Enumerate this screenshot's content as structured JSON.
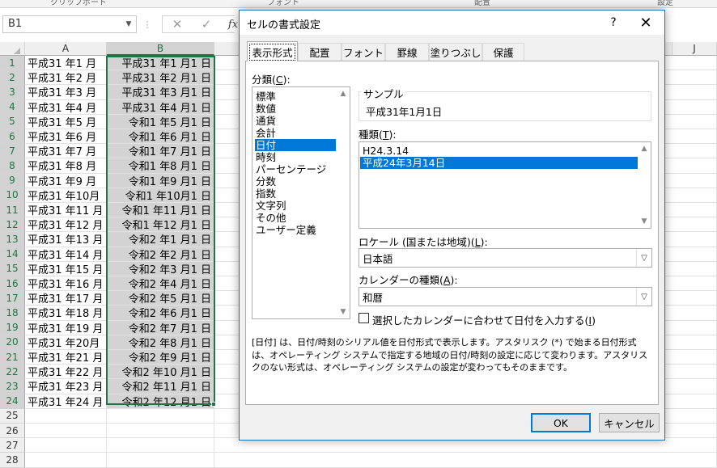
{
  "ribbon": {
    "items": [
      "クリップボード",
      "フォント",
      "配置",
      "設定"
    ]
  },
  "formula_bar": {
    "name_box": "B1",
    "cancel_glyph": "✕",
    "enter_glyph": "✓",
    "fx": "fx"
  },
  "sheet": {
    "columns": [
      "A",
      "B",
      "J"
    ],
    "rows": [
      {
        "n": "1",
        "a": "平成31 年1 月",
        "b": "平成31 年1 月1 日"
      },
      {
        "n": "2",
        "a": "平成31 年2 月",
        "b": "平成31 年2 月1 日"
      },
      {
        "n": "3",
        "a": "平成31 年3 月",
        "b": "平成31 年3 月1 日"
      },
      {
        "n": "4",
        "a": "平成31 年4 月",
        "b": "平成31 年4 月1 日"
      },
      {
        "n": "5",
        "a": "平成31 年5 月",
        "b": "令和1 年5 月1 日"
      },
      {
        "n": "6",
        "a": "平成31 年6 月",
        "b": "令和1 年6 月1 日"
      },
      {
        "n": "7",
        "a": "平成31 年7 月",
        "b": "令和1 年7 月1 日"
      },
      {
        "n": "8",
        "a": "平成31 年8 月",
        "b": "令和1 年8 月1 日"
      },
      {
        "n": "9",
        "a": "平成31 年9 月",
        "b": "令和1 年9 月1 日"
      },
      {
        "n": "10",
        "a": "平成31 年10月",
        "b": "令和1 年10月1 日"
      },
      {
        "n": "11",
        "a": "平成31 年11 月",
        "b": "令和1 年11 月1 日"
      },
      {
        "n": "12",
        "a": "平成31 年12 月",
        "b": "令和1 年12 月1 日"
      },
      {
        "n": "13",
        "a": "平成31 年13 月",
        "b": "令和2 年1 月1 日"
      },
      {
        "n": "14",
        "a": "平成31 年14 月",
        "b": "令和2 年2 月1 日"
      },
      {
        "n": "15",
        "a": "平成31 年15 月",
        "b": "令和2 年3 月1 日"
      },
      {
        "n": "16",
        "a": "平成31 年16 月",
        "b": "令和2 年4 月1 日"
      },
      {
        "n": "17",
        "a": "平成31 年17 月",
        "b": "令和2 年5 月1 日"
      },
      {
        "n": "18",
        "a": "平成31 年18 月",
        "b": "令和2 年6 月1 日"
      },
      {
        "n": "19",
        "a": "平成31 年19 月",
        "b": "令和2 年7 月1 日"
      },
      {
        "n": "20",
        "a": "平成31 年20月",
        "b": "令和2 年8 月1 日"
      },
      {
        "n": "21",
        "a": "平成31 年21 月",
        "b": "令和2 年9 月1 日"
      },
      {
        "n": "22",
        "a": "平成31 年22 月",
        "b": "令和2 年10 月1 日"
      },
      {
        "n": "23",
        "a": "平成31 年23 月",
        "b": "令和2 年11 月1 日"
      },
      {
        "n": "24",
        "a": "平成31 年24 月",
        "b": "令和2 年12 月1 日"
      },
      {
        "n": "25",
        "a": "",
        "b": ""
      },
      {
        "n": "26",
        "a": "",
        "b": ""
      },
      {
        "n": "27",
        "a": "",
        "b": ""
      },
      {
        "n": "28",
        "a": "",
        "b": ""
      }
    ]
  },
  "dialog": {
    "title": "セルの書式設定",
    "help": "?",
    "close": "✕",
    "tabs": [
      "表示形式",
      "配置",
      "フォント",
      "罫線",
      "塗りつぶし",
      "保護"
    ],
    "category_label": "分類(",
    "category_key": "C",
    "category_label_end": "):",
    "categories": [
      "標準",
      "数値",
      "通貨",
      "会計",
      "日付",
      "時刻",
      "パーセンテージ",
      "分数",
      "指数",
      "文字列",
      "その他",
      "ユーザー定義"
    ],
    "selected_category": "日付",
    "sample_label": "サンプル",
    "sample_value": "平成31年1月1日",
    "type_label": "種類(",
    "type_key": "T",
    "type_label_end": "):",
    "types": [
      "H24.3.14",
      "平成24年3月14日"
    ],
    "selected_type": "平成24年3月14日",
    "locale_label": "ロケール (国または地域)(",
    "locale_key": "L",
    "locale_label_end": "):",
    "locale_value": "日本語",
    "calendar_label": "カレンダーの種類(",
    "calendar_key": "A",
    "calendar_label_end": "):",
    "calendar_value": "和暦",
    "checkbox_label": "選択したカレンダーに合わせて日付を入力する(",
    "checkbox_key": "I",
    "checkbox_label_end": ")",
    "description": "[日付] は、日付/時刻のシリアル値を日付形式で表示します。アスタリスク (*) で始まる日付形式は、オペレーティング システムで指定する地域の日付/時刻の設定に応じて変わります。アスタリスクのない形式は、オペレーティング システムの設定が変わってもそのままです。",
    "ok": "OK",
    "cancel": "キャンセル"
  }
}
